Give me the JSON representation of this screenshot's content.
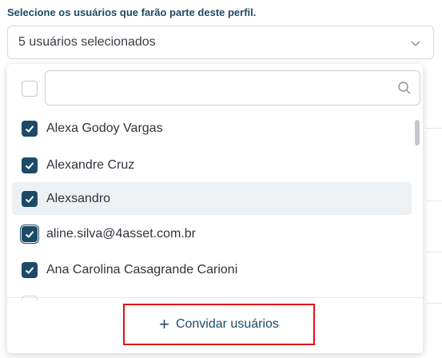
{
  "form": {
    "label": "Selecione os usuários que farão parte deste perfil.",
    "select_value": "5 usuários selecionados"
  },
  "dropdown": {
    "search": {
      "value": "",
      "placeholder": ""
    },
    "items": [
      {
        "name": "Alexa Godoy Vargas",
        "checked": true
      },
      {
        "name": "Alexandre Cruz",
        "checked": true
      },
      {
        "name": "Alexsandro",
        "checked": true
      },
      {
        "name": "aline.silva@4asset.com.br",
        "checked": true
      },
      {
        "name": "Ana Carolina Casagrande Carioni",
        "checked": true
      }
    ],
    "invite_label": "Convidar usuários",
    "invite_icon": "plus-icon"
  },
  "colors": {
    "accent": "#1d4a66",
    "highlight_border": "#e0101b",
    "hover_bg": "#eef1f4"
  }
}
